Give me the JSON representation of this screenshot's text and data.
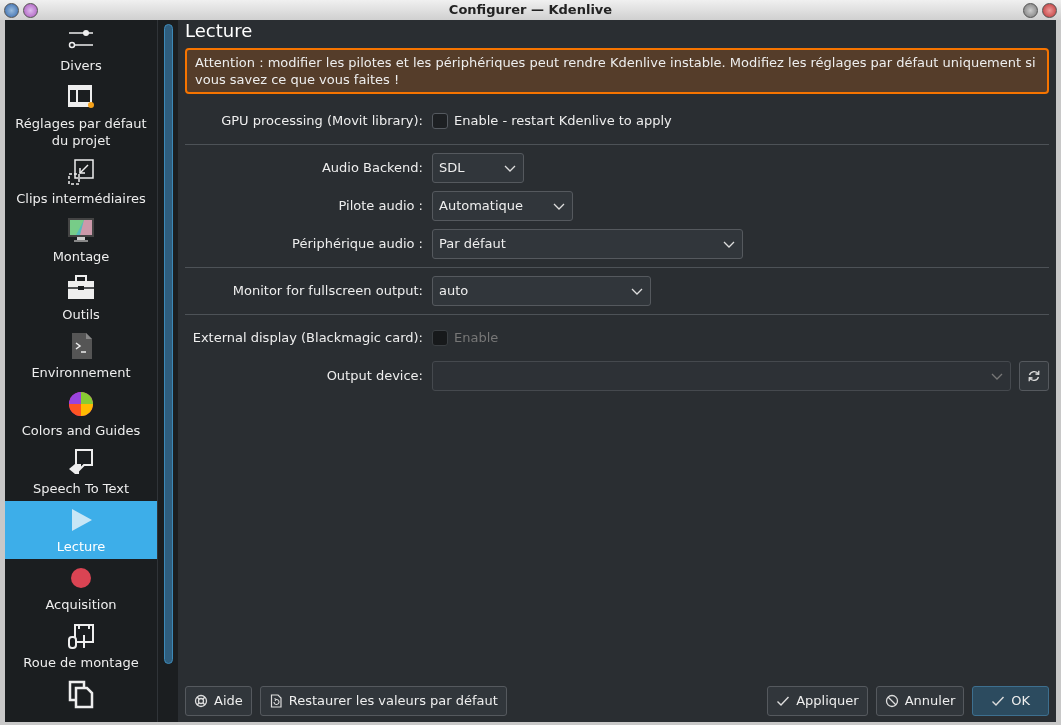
{
  "window": {
    "title": "Configurer — Kdenlive"
  },
  "sidebar": {
    "items": [
      {
        "label": "Divers",
        "selected": false
      },
      {
        "label": "Réglages par défaut du projet",
        "selected": false
      },
      {
        "label": "Clips intermédiaires",
        "selected": false
      },
      {
        "label": "Montage",
        "selected": false
      },
      {
        "label": "Outils",
        "selected": false
      },
      {
        "label": "Environnement",
        "selected": false
      },
      {
        "label": "Colors and Guides",
        "selected": false
      },
      {
        "label": "Speech To Text",
        "selected": false
      },
      {
        "label": "Lecture",
        "selected": true
      },
      {
        "label": "Acquisition",
        "selected": false
      },
      {
        "label": "Roue de montage",
        "selected": false
      },
      {
        "selected": false
      }
    ]
  },
  "page": {
    "title": "Lecture",
    "warning": "Attention : modifier les pilotes et les périphériques peut rendre Kdenlive instable. Modifiez les réglages par défaut uniquement si vous savez ce que vous faites !",
    "rows": [
      {
        "kind": "checkbox",
        "label": "GPU processing (Movit library):",
        "text": "Enable - restart Kdenlive to apply",
        "checked": false,
        "disabled": false
      },
      {
        "kind": "separator"
      },
      {
        "kind": "select",
        "label": "Audio Backend:",
        "value": "SDL"
      },
      {
        "kind": "select",
        "label": "Pilote audio :",
        "value": "Automatique"
      },
      {
        "kind": "select",
        "label": "Périphérique audio :",
        "value": "Par défaut"
      },
      {
        "kind": "separator"
      },
      {
        "kind": "select",
        "label": "Monitor for fullscreen output:",
        "value": "auto"
      },
      {
        "kind": "separator"
      },
      {
        "kind": "checkbox",
        "label": "External display (Blackmagic card):",
        "text": "Enable",
        "checked": false,
        "disabled": true
      },
      {
        "kind": "select_refresh",
        "label": "Output device:",
        "disabled": true
      }
    ]
  },
  "buttons_left": [
    {
      "label": "Aide"
    },
    {
      "label": "Restaurer les valeurs par défaut"
    }
  ],
  "buttons_right": [
    {
      "label": "Appliquer",
      "default": false
    },
    {
      "label": "Annuler",
      "default": false
    },
    {
      "label": "OK",
      "default": true
    }
  ]
}
